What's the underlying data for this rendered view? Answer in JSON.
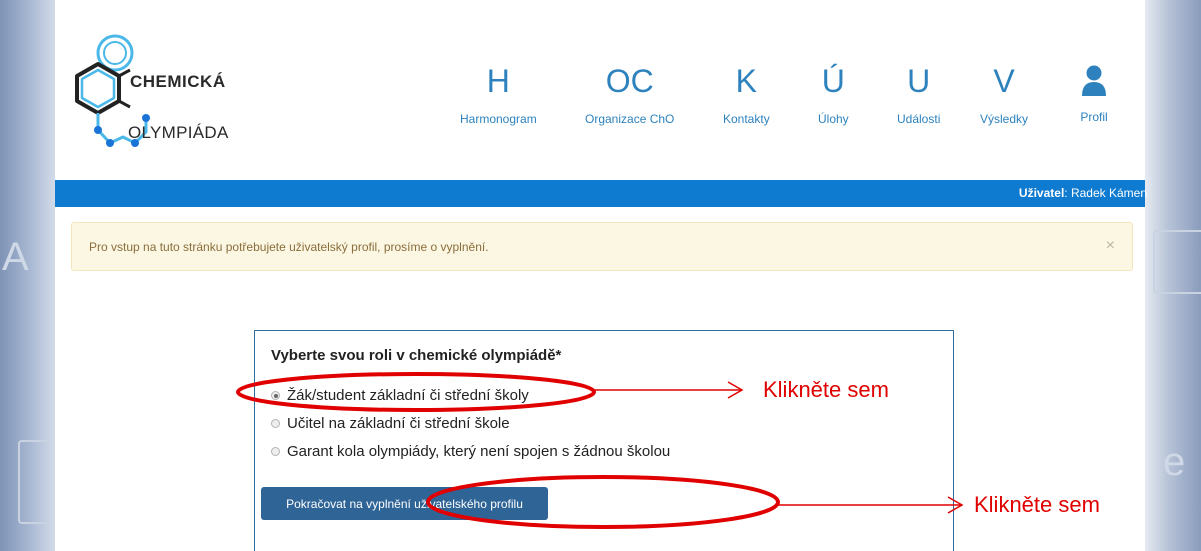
{
  "logo": {
    "line1": "CHEMICKÁ",
    "line2": "OLYMPIÁDA"
  },
  "nav": [
    {
      "letter": "H",
      "label": "Harmonogram"
    },
    {
      "letter": "OC",
      "label": "Organizace ChO"
    },
    {
      "letter": "K",
      "label": "Kontakty"
    },
    {
      "letter": "Ú",
      "label": "Úlohy"
    },
    {
      "letter": "U",
      "label": "Události"
    },
    {
      "letter": "V",
      "label": "Výsledky"
    },
    {
      "icon": "user-icon",
      "label": "Profil"
    }
  ],
  "userbar": {
    "label": "Uživatel",
    "sep": ": ",
    "name": "Radek Kámen"
  },
  "alert": {
    "message": "Pro vstup na tuto stránku potřebujete uživatelský profil, prosíme o vyplnění.",
    "close": "×"
  },
  "role_form": {
    "title": "Vyberte svou roli v chemické olympiádě*",
    "options": [
      {
        "label": "Žák/student základní či střední školy",
        "checked": true
      },
      {
        "label": "Učitel na základní či střední škole",
        "checked": false
      },
      {
        "label": "Garant kola olympiády, který není spojen s žádnou školou",
        "checked": false
      }
    ],
    "submit": "Pokračovat na vyplnění uživatelského profilu"
  },
  "annotations": {
    "click_here_1": "Klikněte sem",
    "click_here_2": "Klikněte sem"
  },
  "colors": {
    "primary": "#0f7bd0",
    "link": "#2d82bd",
    "button": "#2f6496",
    "annotation": "#e00000",
    "alert_bg": "#fcf7e3"
  }
}
